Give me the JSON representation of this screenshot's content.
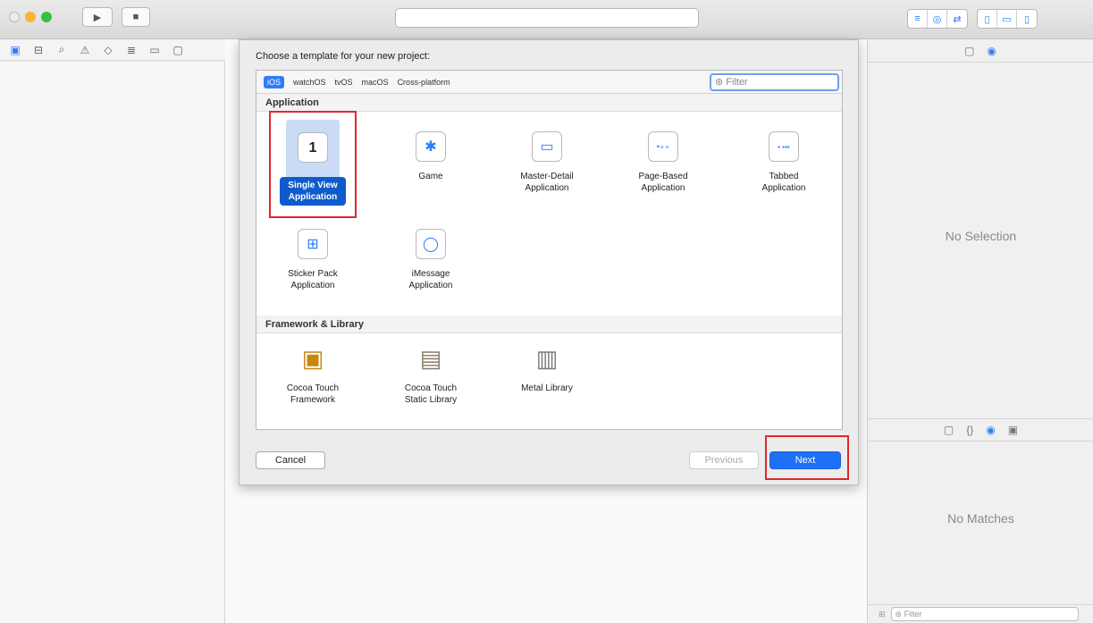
{
  "toolbar": {
    "run_icon": "play-icon",
    "stop_icon": "stop-icon"
  },
  "navigator": {
    "icons": [
      "folder-icon",
      "hierarchy-icon",
      "search-icon",
      "warning-icon",
      "test-icon",
      "debug-icon",
      "breakpoint-icon",
      "report-icon"
    ]
  },
  "dialog": {
    "title": "Choose a template for your new project:",
    "platforms": [
      "iOS",
      "watchOS",
      "tvOS",
      "macOS",
      "Cross-platform"
    ],
    "filter_placeholder": "Filter",
    "sections": [
      {
        "title": "Application"
      },
      {
        "title": "Framework & Library"
      }
    ],
    "application_templates": [
      {
        "line1": "Single View",
        "line2": "Application",
        "icon_text": "1"
      },
      {
        "line1": "Game",
        "line2": "",
        "icon_text": "✱"
      },
      {
        "line1": "Master-Detail",
        "line2": "Application",
        "icon_text": "▭"
      },
      {
        "line1": "Page-Based",
        "line2": "Application",
        "icon_text": "•∘∘"
      },
      {
        "line1": "Tabbed",
        "line2": "Application",
        "icon_text": "▪ ▪▪▪"
      },
      {
        "line1": "Sticker Pack",
        "line2": "Application",
        "icon_text": "⊞"
      },
      {
        "line1": "iMessage",
        "line2": "Application",
        "icon_text": "◯"
      }
    ],
    "framework_templates": [
      {
        "line1": "Cocoa Touch",
        "line2": "Framework",
        "icon_text": "▣"
      },
      {
        "line1": "Cocoa Touch",
        "line2": "Static Library",
        "icon_text": "▤"
      },
      {
        "line1": "Metal Library",
        "line2": "",
        "icon_text": "▥"
      }
    ],
    "buttons": {
      "cancel": "Cancel",
      "previous": "Previous",
      "next": "Next"
    }
  },
  "inspector": {
    "no_selection": "No Selection",
    "no_matches": "No Matches",
    "filter_placeholder": "Filter"
  },
  "colors": {
    "accent": "#2f7cf6",
    "selection": "#0f5bcd",
    "highlight_box": "#e0282a"
  }
}
